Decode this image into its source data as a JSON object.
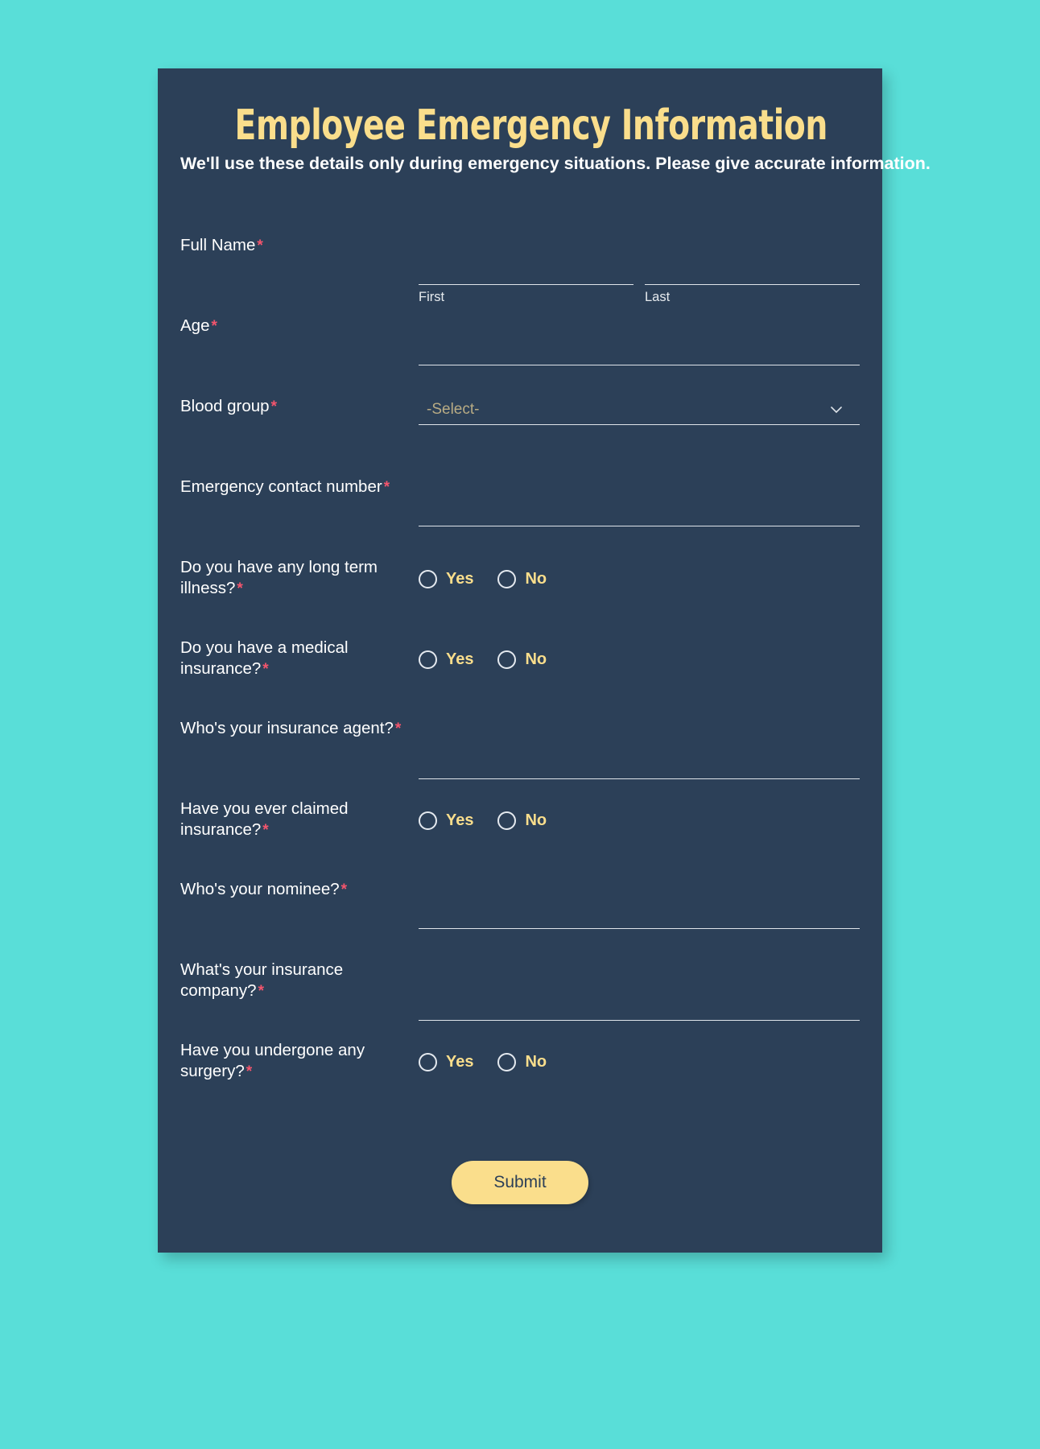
{
  "theme": {
    "page_background": "#59ded8",
    "card_background": "#2c4058",
    "accent_yellow": "#fade8c",
    "required_red": "#f4556d",
    "placeholder_khaki": "#b8ab84"
  },
  "header": {
    "title": "Employee Emergency Information",
    "subtitle": "We'll use these details only during emergency situations. Please give accurate information."
  },
  "required_marker": "*",
  "fields": {
    "full_name": {
      "label": "Full Name",
      "first": {
        "value": "",
        "sub_label": "First"
      },
      "last": {
        "value": "",
        "sub_label": "Last"
      }
    },
    "age": {
      "label": "Age",
      "value": ""
    },
    "blood_group": {
      "label": "Blood group",
      "selected": "-Select-"
    },
    "emergency_contact": {
      "label": "Emergency contact number",
      "value": ""
    },
    "long_term_illness": {
      "label": "Do you have any long term illness?"
    },
    "medical_insurance": {
      "label": "Do you have a medical insurance?"
    },
    "insurance_agent": {
      "label": "Who's your insurance agent?",
      "value": ""
    },
    "claimed_insurance": {
      "label": "Have you ever claimed insurance?"
    },
    "nominee": {
      "label": "Who's your nominee?",
      "value": ""
    },
    "insurance_company": {
      "label": "What's your insurance company?",
      "value": ""
    },
    "surgery": {
      "label": "Have you undergone any surgery?"
    }
  },
  "radio_options": {
    "yes": "Yes",
    "no": "No"
  },
  "submit": {
    "label": "Submit"
  }
}
